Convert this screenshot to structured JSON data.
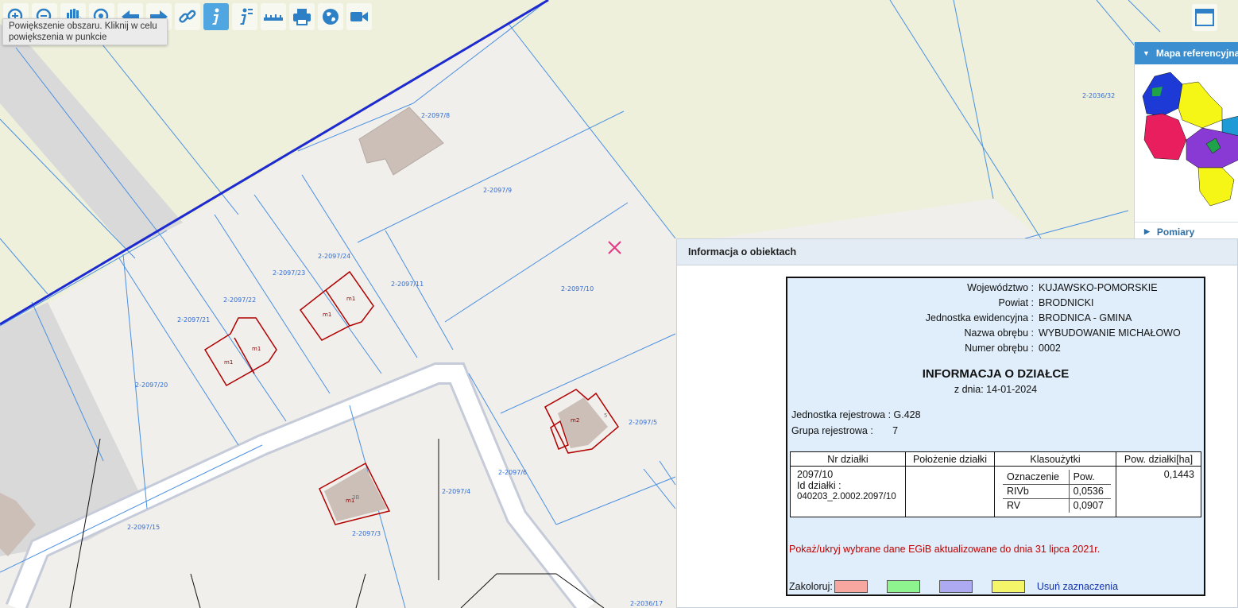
{
  "toolbar": {
    "tools": [
      {
        "name": "zoom-in-icon",
        "active": false
      },
      {
        "name": "zoom-out-icon",
        "active": false
      },
      {
        "name": "pan-hand-icon",
        "active": false
      },
      {
        "name": "zoom-full-icon",
        "active": false
      },
      {
        "name": "back-arrow-icon",
        "active": false
      },
      {
        "name": "forward-arrow-icon",
        "active": false
      },
      {
        "name": "link-icon",
        "active": false
      },
      {
        "name": "info-icon",
        "active": true
      },
      {
        "name": "info-list-icon",
        "active": false
      },
      {
        "name": "measure-ruler-icon",
        "active": false
      },
      {
        "name": "print-icon",
        "active": false
      },
      {
        "name": "globe-icon",
        "active": false
      },
      {
        "name": "video-camera-icon",
        "active": false
      }
    ],
    "tooltip": "Powiększenie obszaru. Kliknij w celu powiększenia w punkcie"
  },
  "reference_map": {
    "title": "Mapa referencyjna",
    "footer": "Pomiary"
  },
  "map": {
    "parcel_labels": [
      "2-2097/8",
      "2-2097/9",
      "2-2097/24",
      "2-2097/23",
      "2-2097/22",
      "2-2097/21",
      "2-2097/20",
      "2-2097/11",
      "2-2097/10",
      "2-2097/5",
      "2-2097/6",
      "2-2097/4",
      "2-2097/3",
      "2-2097/15",
      "2-2036/32",
      "2-2036/17"
    ],
    "building_labels": [
      "m1",
      "m1",
      "m1",
      "m1",
      "m2",
      "m1"
    ],
    "house_numbers": [
      "3B",
      "5"
    ]
  },
  "info_panel": {
    "title": "Informacja o obiektach",
    "meta": [
      {
        "label": "Województwo :",
        "value": "KUJAWSKO-POMORSKIE"
      },
      {
        "label": "Powiat :",
        "value": "BRODNICKI"
      },
      {
        "label": "Jednostka ewidencyjna :",
        "value": "BRODNICA - GMINA"
      },
      {
        "label": "Nazwa obrębu :",
        "value": "WYBUDOWANIE MICHAŁOWO"
      },
      {
        "label": "Numer obrębu :",
        "value": "0002"
      }
    ],
    "doc_title": "INFORMACJA O DZIAŁCE",
    "doc_date": "z dnia: 14-01-2024",
    "registry": [
      {
        "text": "Jednostka rejestrowa : G.428"
      },
      {
        "text": "Grupa rejestrowa :       7"
      }
    ],
    "table": {
      "headers": [
        "Nr działki",
        "Położenie działki",
        "Klasoużytki",
        "Pow. działki[ha]"
      ],
      "parcel_number": "2097/10",
      "parcel_id_label": "Id działki :",
      "parcel_id": "040203_2.0002.2097/10",
      "location": "",
      "klas_headers": [
        "Oznaczenie",
        "Pow."
      ],
      "klas_rows": [
        {
          "code": "RIVb",
          "area": "0,0536"
        },
        {
          "code": "RV",
          "area": "0,0907"
        }
      ],
      "total_area": "0,1443"
    },
    "egib_link": "Pokaż/ukryj wybrane dane EGiB aktualizowane do dnia 31 lipca 2021r.",
    "colorize_label": "Zakoloruj:",
    "colors": [
      "#f7a6a0",
      "#8ef58e",
      "#aeaaf2",
      "#f5f56a"
    ],
    "clear_link": "Usuń zaznaczenia"
  },
  "colors": {
    "map_background": "#f1efeb",
    "farmland": "#eef0dc",
    "parcel_lines": "#4a90e2",
    "buildings_outline": "#b00000",
    "road_fill": "#ffffff",
    "accent_blue": "#3b8fd0",
    "marker_pink": "#e23a82"
  }
}
